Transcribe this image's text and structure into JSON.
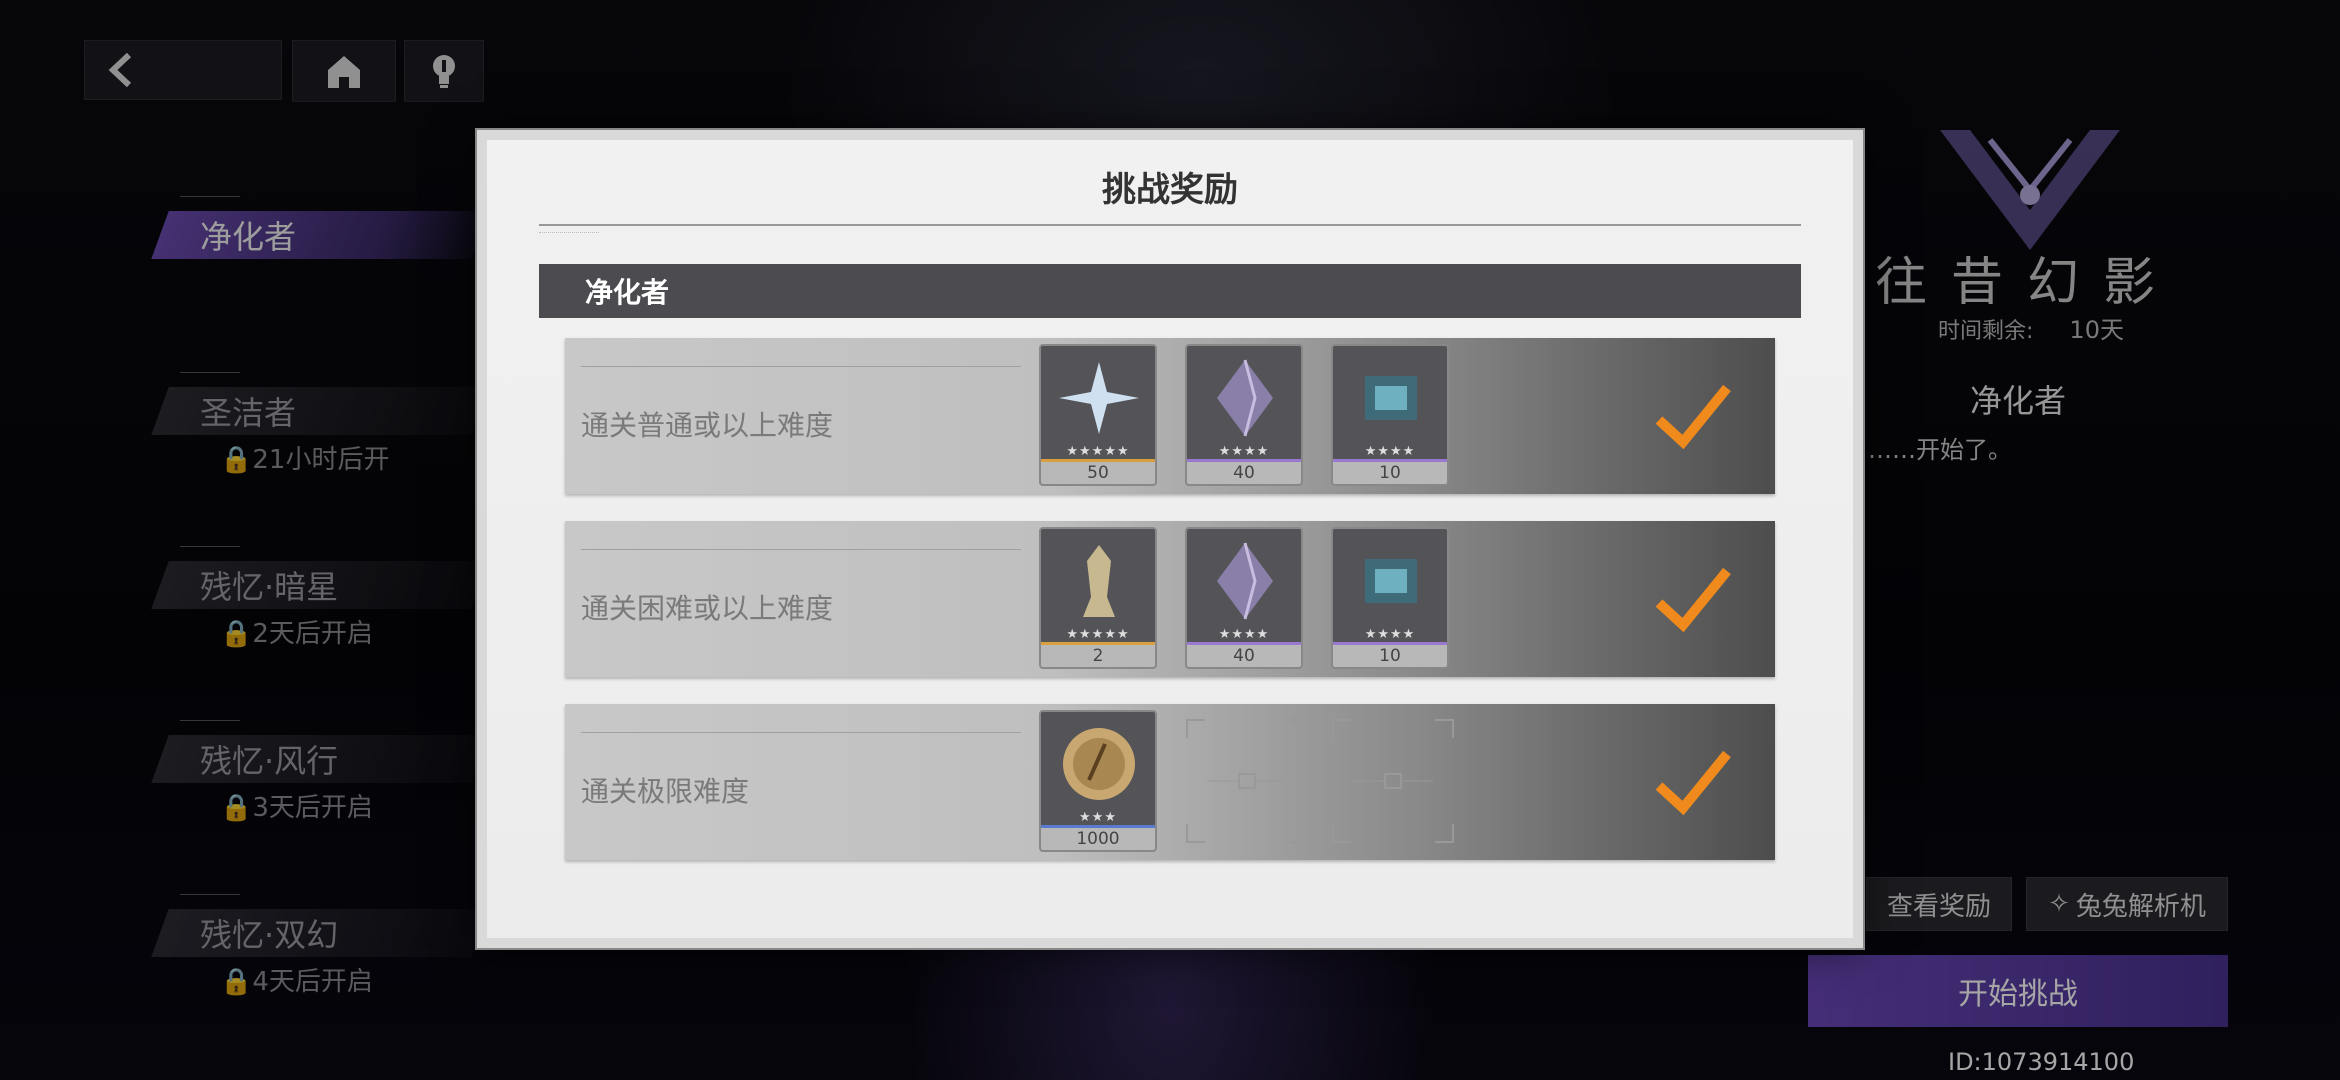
{
  "nav": {
    "back_icon": "back-arrow-icon",
    "home_icon": "home-icon",
    "hint_icon": "lightbulb-icon"
  },
  "stages": [
    {
      "name": "净化者",
      "active": true,
      "lock": ""
    },
    {
      "name": "圣洁者",
      "active": false,
      "lock": "21小时后开"
    },
    {
      "name": "残忆·暗星",
      "active": false,
      "lock": "2天后开启"
    },
    {
      "name": "残忆·风行",
      "active": false,
      "lock": "3天后开启"
    },
    {
      "name": "残忆·双幻",
      "active": false,
      "lock": "4天后开启"
    }
  ],
  "event": {
    "title": "往昔幻影",
    "time_label": "时间剩余:",
    "time_value": "10天",
    "stage_name": "净化者",
    "desc": "……开始了。"
  },
  "buttons": {
    "view_rewards": "查看奖励",
    "analyzer": "兔兔解析机",
    "start": "开始挑战"
  },
  "uid": "ID:1073914100",
  "modal": {
    "title": "挑战奖励",
    "section": "净化者",
    "rows": [
      {
        "condition": "通关普通或以上难度",
        "completed": true,
        "items": [
          {
            "icon": "crystal-shard-icon",
            "count": "50",
            "stars": "★★★★★",
            "quality": "#d9a040"
          },
          {
            "icon": "purple-crystal-icon",
            "count": "40",
            "stars": "★★★★",
            "quality": "#9a78d0"
          },
          {
            "icon": "blue-chip-icon",
            "count": "10",
            "stars": "★★★★",
            "quality": "#9a78d0"
          }
        ]
      },
      {
        "condition": "通关困难或以上难度",
        "completed": true,
        "items": [
          {
            "icon": "figure-statue-icon",
            "count": "2",
            "stars": "★★★★★",
            "quality": "#d9a040"
          },
          {
            "icon": "purple-crystal-icon",
            "count": "40",
            "stars": "★★★★",
            "quality": "#9a78d0"
          },
          {
            "icon": "blue-chip-icon",
            "count": "10",
            "stars": "★★★★",
            "quality": "#9a78d0"
          }
        ]
      },
      {
        "condition": "通关极限难度",
        "completed": true,
        "items": [
          {
            "icon": "gold-coin-icon",
            "count": "1000",
            "stars": "★★★",
            "quality": "#5a7ad0"
          }
        ]
      }
    ],
    "check_color": "#f08a1c"
  }
}
